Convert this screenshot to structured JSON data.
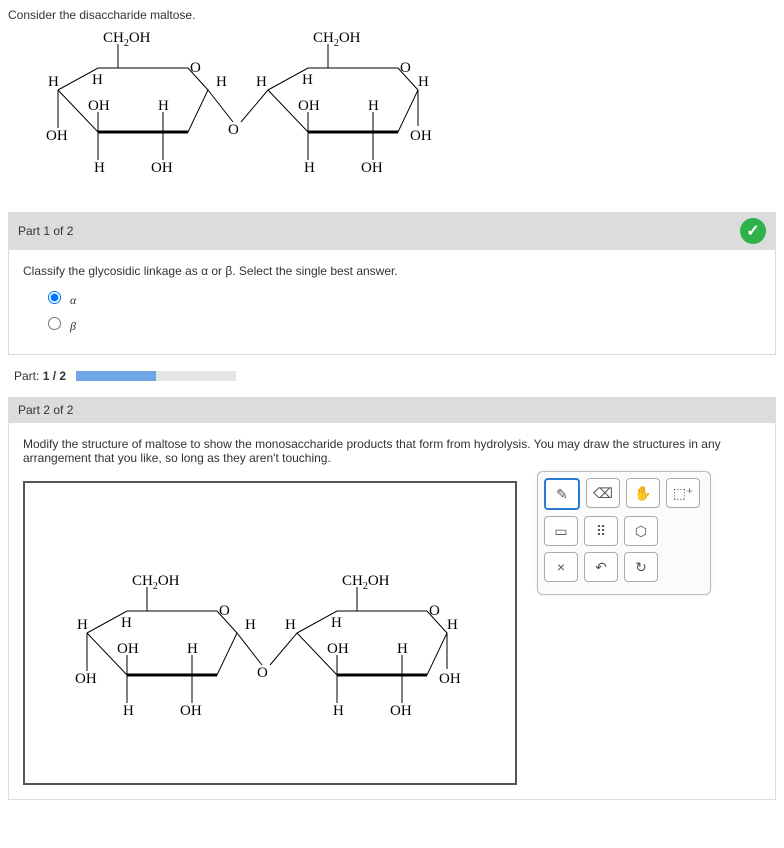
{
  "intro": "Consider the disaccharide maltose.",
  "labels": {
    "ch2oh": "CH",
    "ch2oh_sub": "2",
    "ch2oh_end": "OH",
    "H": "H",
    "OH": "OH",
    "O": "O"
  },
  "part1": {
    "header": "Part 1 of 2",
    "question": "Classify the glycosidic linkage as α or β. Select the single best answer.",
    "options": {
      "a": "α",
      "b": "β"
    }
  },
  "progress": {
    "label_prefix": "Part: ",
    "value": "1 / 2"
  },
  "part2": {
    "header": "Part 2 of 2",
    "question": "Modify the structure of maltose to show the monosaccharide products that form from hydrolysis. You may draw the structures in any arrangement that you like, so long as they aren't touching."
  },
  "tools": {
    "pencil": "✎",
    "eraser": "⌫",
    "hand": "✋",
    "expand": "⬚⁺",
    "rect": "▭",
    "rect_dots": "⠿",
    "ring": "⬡",
    "close": "×",
    "undo": "↶",
    "redo": "↻"
  }
}
